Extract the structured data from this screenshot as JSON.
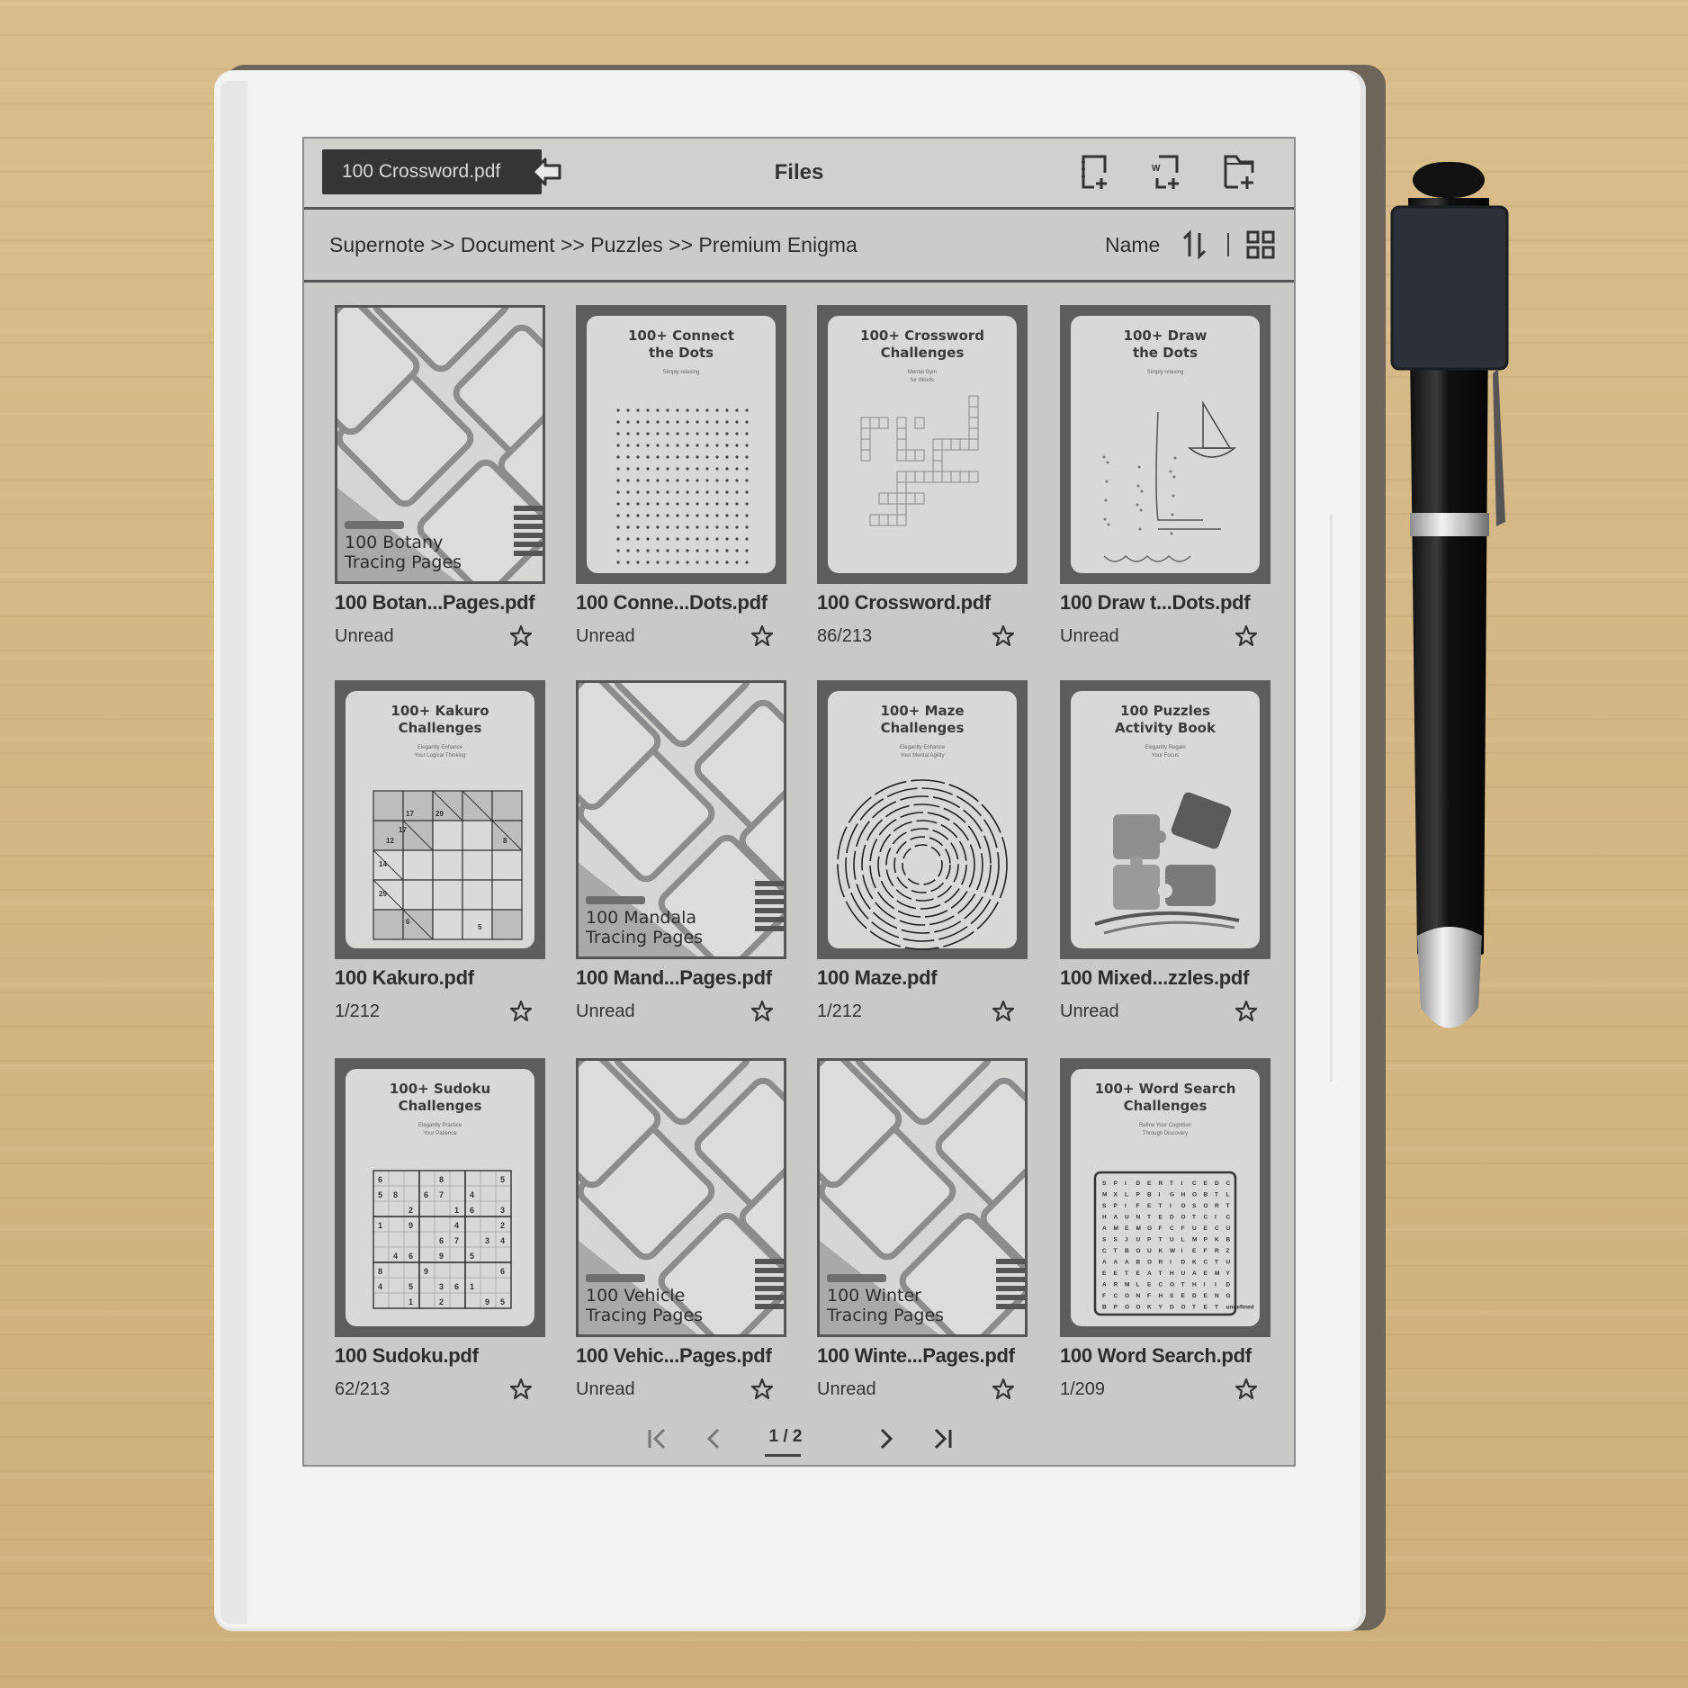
{
  "topbar": {
    "open_document": "100 Crossword.pdf",
    "title": "Files",
    "icons": [
      "new-note-icon",
      "new-word-document-icon",
      "new-folder-icon",
      "favorites-star-icon"
    ]
  },
  "breadcrumb": {
    "path": "Supernote >> Document >> Puzzles >> Premium Enigma",
    "sort_label": "Name",
    "sort_icon": "sort-order-icon",
    "view_icon": "grid-view-icon"
  },
  "files": [
    {
      "name": "100 Botan...Pages.pdf",
      "status": "Unread",
      "cover_type": "tracing",
      "cover_title": "100 Botany\nTracing Pages"
    },
    {
      "name": "100 Conne...Dots.pdf",
      "status": "Unread",
      "cover_type": "dots",
      "cover_title": "100+ Connect\nthe Dots",
      "cover_sub": "Simply relaxing"
    },
    {
      "name": "100 Crossword.pdf",
      "status": "86/213",
      "cover_type": "crossword",
      "cover_title": "100+ Crossword\nChallenges",
      "cover_sub": "Mental Gym\nfor Words"
    },
    {
      "name": "100 Draw t...Dots.pdf",
      "status": "Unread",
      "cover_type": "draw",
      "cover_title": "100+ Draw\nthe Dots",
      "cover_sub": "Simply relaxing"
    },
    {
      "name": "100 Kakuro.pdf",
      "status": "1/212",
      "cover_type": "kakuro",
      "cover_title": "100+ Kakuro\nChallenges",
      "cover_sub": "Elegantly Enhance\nYour Logical Thinking"
    },
    {
      "name": "100 Mand...Pages.pdf",
      "status": "Unread",
      "cover_type": "tracing",
      "cover_title": "100 Mandala\nTracing Pages"
    },
    {
      "name": "100 Maze.pdf",
      "status": "1/212",
      "cover_type": "maze",
      "cover_title": "100+ Maze\nChallenges",
      "cover_sub": "Elegantly Enhance\nYour Mental Agility"
    },
    {
      "name": "100 Mixed...zzles.pdf",
      "status": "Unread",
      "cover_type": "puzzle",
      "cover_title": "100 Puzzles\nActivity Book",
      "cover_sub": "Elegantly Regain\nYour Focus"
    },
    {
      "name": "100 Sudoku.pdf",
      "status": "62/213",
      "cover_type": "sudoku",
      "cover_title": "100+ Sudoku\nChallenges",
      "cover_sub": "Elegantly Practice\nYour Patience"
    },
    {
      "name": "100 Vehic...Pages.pdf",
      "status": "Unread",
      "cover_type": "tracing",
      "cover_title": "100 Vehicle\nTracing Pages"
    },
    {
      "name": "100 Winte...Pages.pdf",
      "status": "Unread",
      "cover_type": "tracing",
      "cover_title": "100 Winter\nTracing Pages"
    },
    {
      "name": "100 Word Search.pdf",
      "status": "1/209",
      "cover_type": "wordsearch",
      "cover_title": "100+ Word Search\nChallenges",
      "cover_sub": "Refine Your Cognition\nThrough Discovery"
    }
  ],
  "kakuro_clues": [
    "17",
    "29",
    "17",
    "12",
    "8",
    "14",
    "29",
    "6",
    "5"
  ],
  "pagination": {
    "current": "1 / 2",
    "first_icon": "first-page-icon",
    "prev_icon": "prev-page-icon",
    "next_icon": "next-page-icon",
    "last_icon": "last-page-icon"
  },
  "colors": {
    "screen_bg": "#c9c9c7",
    "open_doc_bg": "#353535",
    "text_dark": "#2d2d2d",
    "device_frame": "#f3f3f2"
  }
}
